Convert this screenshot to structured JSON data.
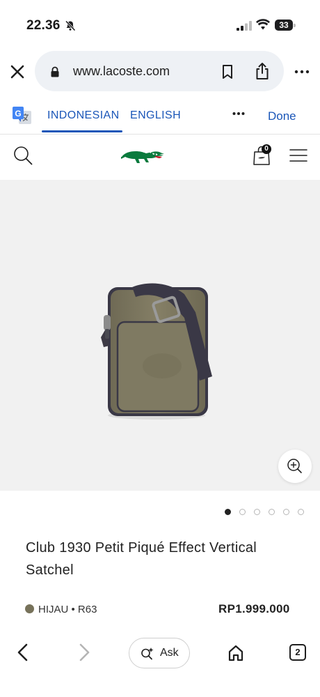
{
  "status_bar": {
    "time": "22.36",
    "battery": "33"
  },
  "browser": {
    "url": "www.lacoste.com",
    "tab_count": "2",
    "ask_label": "Ask"
  },
  "translate_bar": {
    "languages": [
      "INDONESIAN",
      "ENGLISH"
    ],
    "active_language": "INDONESIAN",
    "done_label": "Done"
  },
  "site_header": {
    "cart_count": "0"
  },
  "product": {
    "title": "Club 1930 Petit Piqué Effect Vertical Satchel",
    "color_label": "HIJAU • R63",
    "price": "RP1.999.000",
    "image_count": 6,
    "active_image_index": 0
  },
  "colors": {
    "accent": "#1a56b8",
    "swatch": "#77725a",
    "logo_green": "#0a7a3d"
  },
  "icons": [
    "bell-off-icon",
    "signal-icon",
    "wifi-icon",
    "battery-icon",
    "close-icon",
    "lock-icon",
    "bookmark-icon",
    "share-icon",
    "more-icon",
    "google-translate-icon",
    "search-icon",
    "lacoste-logo",
    "shopping-bag-icon",
    "menu-icon",
    "zoom-in-icon",
    "back-icon",
    "forward-icon",
    "ask-sparkle-icon",
    "home-icon",
    "tabs-icon"
  ]
}
